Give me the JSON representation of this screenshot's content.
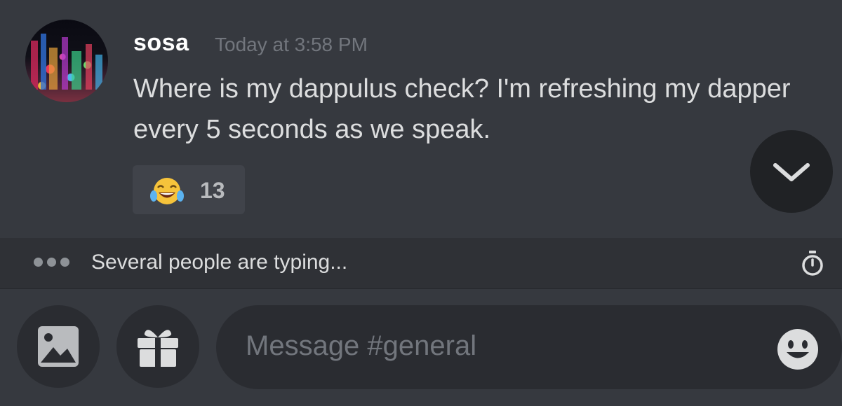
{
  "message": {
    "username": "sosa",
    "timestamp": "Today at 3:58 PM",
    "text": "Where is my dappulus check? I'm refreshing my dapper every 5 seconds as we speak.",
    "reaction": {
      "emoji_icon": "joy-emoji-icon",
      "count": "13"
    }
  },
  "typing": {
    "text": "Several people are typing..."
  },
  "composer": {
    "placeholder": "Message #general"
  },
  "icons": {
    "avatar": "city-night-avatar",
    "scroll_down": "chevron-down-icon",
    "timer": "stopwatch-icon",
    "image": "image-icon",
    "gift": "gift-icon",
    "emoji": "smile-icon"
  },
  "colors": {
    "background": "#36393f",
    "username": "#ffffff",
    "timestamp": "#72767d",
    "message_text": "#dcddde",
    "input_bg": "#2a2c31"
  }
}
